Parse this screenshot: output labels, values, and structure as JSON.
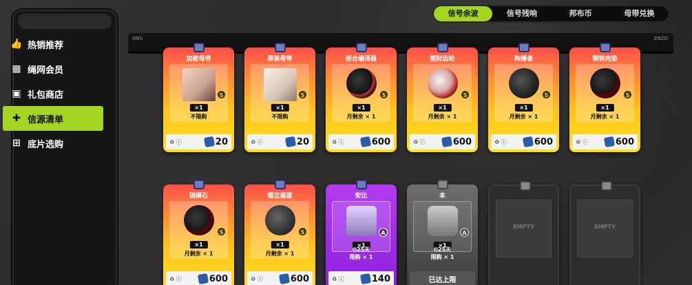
{
  "sidebar": {
    "items": [
      {
        "label": "热销推荐",
        "icon": "thumbs-up-icon"
      },
      {
        "label": "绳网会员",
        "icon": "calendar-icon"
      },
      {
        "label": "礼包商店",
        "icon": "gift-icon"
      },
      {
        "label": "信源清单",
        "icon": "puzzle-icon"
      },
      {
        "label": "底片选购",
        "icon": "windows-icon"
      }
    ],
    "active_index": 3
  },
  "tabs": {
    "items": [
      "信号余波",
      "信号残响",
      "邦布币",
      "母带兑换"
    ],
    "active_index": 0
  },
  "rail": {
    "left_tag": "ONS",
    "right_tag": "ZNZO"
  },
  "cards_row1": [
    {
      "name": "加密母带",
      "qty": "×1",
      "note": "不限购",
      "price": "20",
      "style": "gold",
      "art": "photo-skin"
    },
    {
      "name": "原装母带",
      "qty": "×1",
      "note": "不限购",
      "price": "20",
      "style": "gold",
      "art": "photo-pale"
    },
    {
      "name": "嵌合编译器",
      "qty": "×1",
      "note": "月剩余 × 1",
      "price": "600",
      "style": "gold",
      "art": "red"
    },
    {
      "name": "燃狱齿轮",
      "qty": "×1",
      "note": "月剩余 × 1",
      "price": "600",
      "style": "gold",
      "art": "pink"
    },
    {
      "name": "拘缚者",
      "qty": "×1",
      "note": "月剩余 × 1",
      "price": "600",
      "style": "gold",
      "art": "dark"
    },
    {
      "name": "钢铁肉垫",
      "qty": "×1",
      "note": "月剩余 × 1",
      "price": "600",
      "style": "gold",
      "art": "black"
    }
  ],
  "cards_row2": [
    {
      "name": "硫磺石",
      "qty": "×1",
      "note": "月剩余 × 1",
      "price": "600",
      "style": "gold",
      "art": "black"
    },
    {
      "name": "啜泣摇篮",
      "qty": "×1",
      "note": "月剩余 × 1",
      "price": "600",
      "style": "gold",
      "art": "stone"
    },
    {
      "name": "安比",
      "qty": "×1",
      "note": "⏲25天",
      "limit": "限购 × 1",
      "price": "140",
      "style": "purple",
      "art": "lav"
    },
    {
      "name": "本",
      "qty": "×1",
      "note": "⏲25天",
      "limit": "限购 × 1",
      "status": "已达上限",
      "style": "gray",
      "art": "tag"
    },
    {
      "empty_label": "EMPTY",
      "style": "empty"
    },
    {
      "empty_label": "EMPTY",
      "style": "empty"
    }
  ]
}
